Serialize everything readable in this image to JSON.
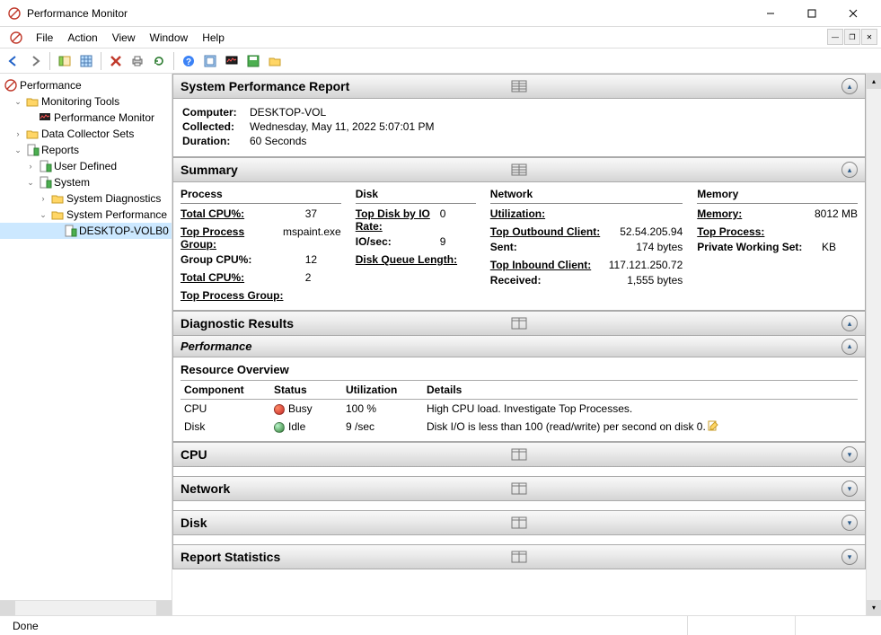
{
  "window": {
    "title": "Performance Monitor"
  },
  "menu": {
    "file": "File",
    "action": "Action",
    "view": "View",
    "window": "Window",
    "help": "Help"
  },
  "tree": {
    "root": "Performance",
    "monitoring": "Monitoring Tools",
    "perfmon": "Performance Monitor",
    "dcs": "Data Collector Sets",
    "reports": "Reports",
    "userdef": "User Defined",
    "system": "System",
    "sysdiag": "System Diagnostics",
    "sysperf": "System Performance",
    "node": "DESKTOP-VOLB0"
  },
  "report": {
    "title": "System Performance Report",
    "computer_label": "Computer:",
    "computer": "DESKTOP-VOL",
    "collected_label": "Collected:",
    "collected": "Wednesday, May 11, 2022 5:07:01 PM",
    "duration_label": "Duration:",
    "duration": "60 Seconds"
  },
  "summary": {
    "title": "Summary",
    "process": {
      "header": "Process",
      "total_cpu_l": "Total CPU%:",
      "total_cpu_v": "37",
      "tpg_l": "Top Process Group:",
      "tpg_v": "mspaint.exe",
      "gcpu_l": "Group CPU%:",
      "gcpu_v": "12",
      "total_cpu2_l": "Total CPU%:",
      "total_cpu2_v": "2",
      "tpg2_l": "Top Process Group:"
    },
    "disk": {
      "header": "Disk",
      "top_l": "Top Disk by IO Rate:",
      "top_v": "0",
      "io_l": "IO/sec:",
      "io_v": "9",
      "dql_l": "Disk Queue Length:"
    },
    "network": {
      "header": "Network",
      "util_l": "Utilization:",
      "out_l": "Top Outbound Client:",
      "out_v": "52.54.205.94",
      "sent_l": "Sent:",
      "sent_v": "174 bytes",
      "in_l": "Top Inbound Client:",
      "in_v": "117.121.250.72",
      "recv_l": "Received:",
      "recv_v": "1,555 bytes"
    },
    "memory": {
      "header": "Memory",
      "mem_l": "Memory:",
      "mem_v": "8012 MB",
      "tp_l": "Top Process:",
      "pws_l": "Private Working Set:",
      "pws_v": "KB"
    }
  },
  "diag": {
    "title": "Diagnostic Results"
  },
  "perf": {
    "title": "Performance"
  },
  "resource": {
    "title": "Resource Overview",
    "cols": {
      "component": "Component",
      "status": "Status",
      "util": "Utilization",
      "details": "Details"
    },
    "rows": [
      {
        "component": "CPU",
        "status": "Busy",
        "color": "red",
        "util": "100 %",
        "details": "High CPU load. Investigate Top Processes."
      },
      {
        "component": "Disk",
        "status": "Idle",
        "color": "green",
        "util": "9 /sec",
        "details": "Disk I/O is less than 100 (read/write) per second on disk 0."
      }
    ]
  },
  "sections": {
    "cpu": "CPU",
    "network": "Network",
    "disk": "Disk",
    "stats": "Report Statistics"
  },
  "status": {
    "text": "Done"
  }
}
